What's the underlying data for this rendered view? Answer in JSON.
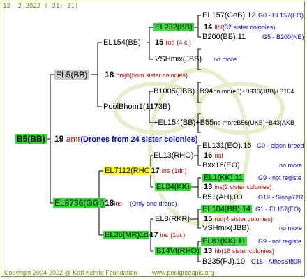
{
  "header": {
    "date": "12-  2-2022 (  21:  31)"
  },
  "footer": {
    "copyright": "Copyright 2004-2022 @ Karl Kehrle Foundation",
    "site": "www.pedigreeapis.org"
  },
  "root": {
    "id": "B5(BB)",
    "num": "19",
    "sym": "amr",
    "desc": "(Drones from 24 sister colonies)"
  },
  "g1": [
    {
      "id": "EL5(BB)",
      "num": "18",
      "sym": "hmjb",
      "desc": "(hom sister colonies)"
    },
    {
      "id": "EL8736(GGI)",
      "num": "18",
      "sym": "ins",
      "desc": "(Only one drone)"
    }
  ],
  "g2": [
    {
      "id": "EL154(BB)",
      "num": "15",
      "sym": "rud",
      "desc": "(4 c.)"
    },
    {
      "id": "PoolBhom1(1",
      "num": "17",
      "suffix": "3B)"
    },
    {
      "id": "EL7112(RHC",
      "num": "17",
      "sym": "ins",
      "desc": "(1dr.)"
    },
    {
      "id": "EL36(MR)1d",
      "num": "17",
      "sym": "ins",
      "desc": "(1dr.)"
    }
  ],
  "g3": [
    {
      "id": "EL232(BB)",
      "num": "14",
      "sym": "lthl",
      "desc": "(32 sister colonies)"
    },
    {
      "id": "VSHmix(JBB)",
      "desc": "no more"
    },
    {
      "id": "B1005(JBB)+B94",
      "desc": "no more3)+B936(JBB)+B104"
    },
    {
      "id": "+EL154(BB)+B55",
      "desc": "no moreB56(UKB)+B43(AKB"
    },
    {
      "id": "EL13(RHO)",
      "num": "16",
      "sym": "nat"
    },
    {
      "id": "EL84(KK)",
      "num": "13",
      "sym": "ins",
      "desc": "(2 sister colonies)"
    },
    {
      "id": "EL8(RKR)",
      "num": "15",
      "sym": "rud",
      "desc": "(4 sister colonies)"
    },
    {
      "id": "B14Vf(RHO)",
      "num": "13",
      "sym": "hb",
      "desc": "(18 sister colonies)"
    }
  ],
  "g4": [
    {
      "name": "EL157(GeB).12",
      "info": "G0 - EL157(EO)"
    },
    {
      "name": "B200(BB).11",
      "info": "G5 - B200(NE)"
    },
    {
      "name": "EL131(EO).16",
      "info": "G0 - elgon breed"
    },
    {
      "name": "Bxx16(EO).",
      "info": "no more"
    },
    {
      "name": "EL1(KK).11",
      "info": "G9 - not registe"
    },
    {
      "name": "B51(AH).09",
      "info": "G19 - Sinop72R"
    },
    {
      "name": "EL104(BB).14",
      "info": "G1 - EL157(EO)"
    },
    {
      "name": "VSHmix(JBB).",
      "info": "no more"
    },
    {
      "name": "EL81(KK).11",
      "info": "G9 - not registe"
    },
    {
      "name": "B235(PJ).10",
      "info": "G15 - AthosSt80R"
    }
  ],
  "colors": {
    "highlight_green": "#33dd33",
    "highlight_yellow": "#ffff00",
    "highlight_gray": "#c8c8c8",
    "red": "#cc0000",
    "blue": "#0000cc"
  }
}
